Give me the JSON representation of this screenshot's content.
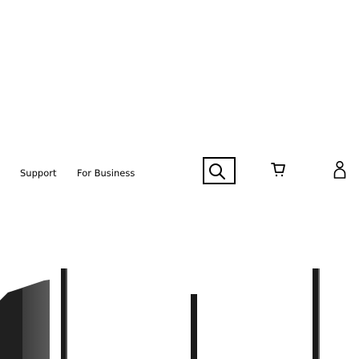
{
  "nav": {
    "items": [
      {
        "label": "Support"
      },
      {
        "label": "For Business"
      }
    ]
  },
  "header_icons": {
    "search": "search-icon",
    "cart": "cart-icon",
    "account": "account-icon"
  },
  "colors": {
    "text": "#000000",
    "background": "#ffffff",
    "hero_bar": "#1a1a1a"
  }
}
